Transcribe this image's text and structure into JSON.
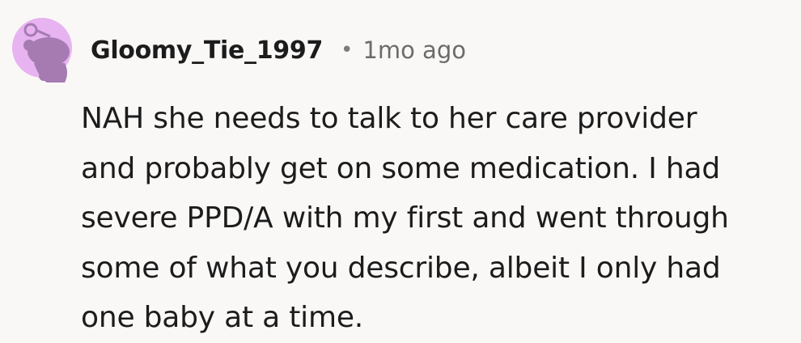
{
  "comment": {
    "author": "Gloomy_Tie_1997",
    "separator": "•",
    "timestamp": "1mo ago",
    "avatar_icon": "reddit-snoo-avatar-icon",
    "avatar_background_color": "#e8b3f1",
    "avatar_figure_color": "#a57bb2",
    "body_lines": [
      "NAH she needs to talk to her care provider",
      "and probably get on some medication. I had",
      "severe PPD/A with my first and went through",
      "some of what you describe, albeit I only had",
      "one baby at a time."
    ]
  }
}
